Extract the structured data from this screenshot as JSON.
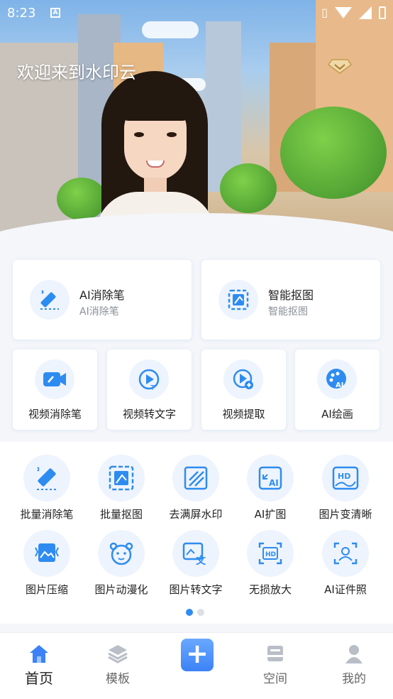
{
  "status_bar": {
    "time": "8:23",
    "notification_icon": "A"
  },
  "hero": {
    "welcome_text": "欢迎来到水印云",
    "vip_icon": "diamond-icon"
  },
  "featured": [
    {
      "title": "AI消除笔",
      "subtitle": "AI消除笔",
      "icon": "eraser-pen-icon"
    },
    {
      "title": "智能抠图",
      "subtitle": "智能抠图",
      "icon": "cutout-icon"
    }
  ],
  "video_tools": [
    {
      "label": "视频消除笔",
      "icon": "video-eraser-icon"
    },
    {
      "label": "视频转文字",
      "icon": "video-to-text-icon"
    },
    {
      "label": "视频提取",
      "icon": "video-extract-icon"
    },
    {
      "label": "AI绘画",
      "icon": "ai-painting-icon"
    }
  ],
  "tools_row1": [
    {
      "label": "批量消除笔",
      "icon": "batch-eraser-icon"
    },
    {
      "label": "批量抠图",
      "icon": "batch-cutout-icon"
    },
    {
      "label": "去满屏水印",
      "icon": "remove-watermark-icon"
    },
    {
      "label": "AI扩图",
      "icon": "ai-expand-icon"
    },
    {
      "label": "图片变清晰",
      "icon": "hd-image-icon"
    }
  ],
  "tools_row2": [
    {
      "label": "图片压缩",
      "icon": "compress-icon"
    },
    {
      "label": "图片动漫化",
      "icon": "anime-icon"
    },
    {
      "label": "图片转文字",
      "icon": "image-to-text-icon"
    },
    {
      "label": "无损放大",
      "icon": "lossless-zoom-icon"
    },
    {
      "label": "AI证件照",
      "icon": "id-photo-icon"
    }
  ],
  "pagination": {
    "active_page": 1,
    "total_pages": 2
  },
  "tabbar": {
    "home": "首页",
    "templates": "模板",
    "plus": "+",
    "space": "空间",
    "mine": "我的"
  },
  "colors": {
    "accent": "#2e8cf0",
    "icon_bg": "#eef4fd"
  }
}
